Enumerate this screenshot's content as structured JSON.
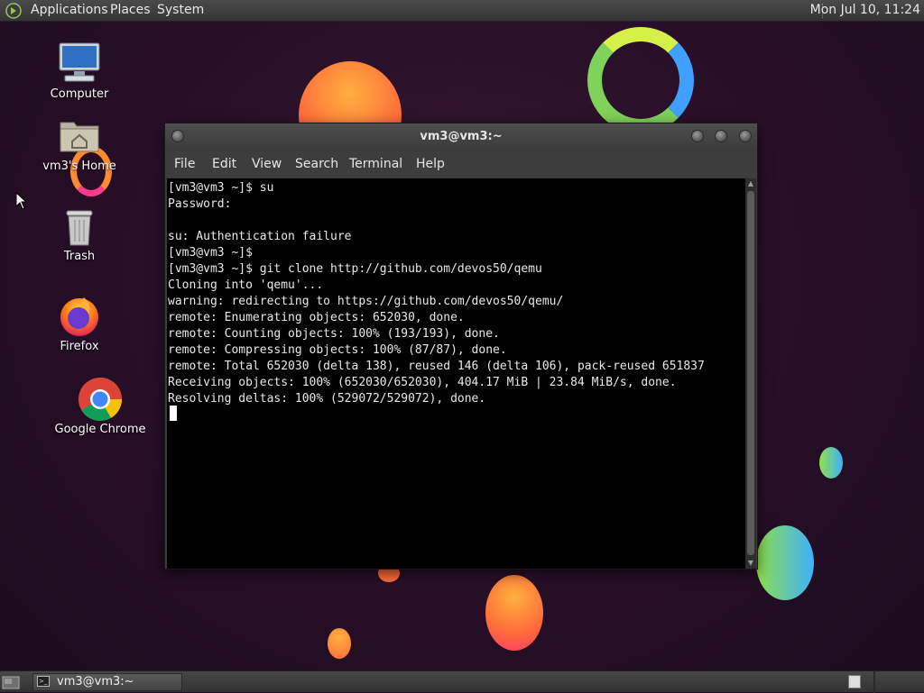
{
  "top_panel": {
    "menus": [
      "Applications",
      "Places",
      "System"
    ],
    "clock": "Mon Jul 10, 11:24",
    "icons": {
      "logo": "distro-logo-icon"
    }
  },
  "desktop": {
    "icons": [
      {
        "label": "Computer",
        "icon": "computer-icon"
      },
      {
        "label": "vm3's Home",
        "icon": "home-folder-icon"
      },
      {
        "label": "Trash",
        "icon": "trash-icon"
      },
      {
        "label": "Firefox",
        "icon": "firefox-icon"
      },
      {
        "label": "Google Chrome",
        "icon": "chrome-icon"
      }
    ]
  },
  "terminal_window": {
    "title": "vm3@vm3:~",
    "menu": [
      "File",
      "Edit",
      "View",
      "Search",
      "Terminal",
      "Help"
    ],
    "lines": [
      "[vm3@vm3 ~]$ su",
      "Password:",
      "",
      "su: Authentication failure",
      "[vm3@vm3 ~]$",
      "[vm3@vm3 ~]$ git clone http://github.com/devos50/qemu",
      "Cloning into 'qemu'...",
      "warning: redirecting to https://github.com/devos50/qemu/",
      "remote: Enumerating objects: 652030, done.",
      "remote: Counting objects: 100% (193/193), done.",
      "remote: Compressing objects: 100% (87/87), done.",
      "remote: Total 652030 (delta 138), reused 146 (delta 106), pack-reused 651837",
      "Receiving objects: 100% (652030/652030), 404.17 MiB | 23.84 MiB/s, done.",
      "Resolving deltas: 100% (529072/529072), done."
    ]
  },
  "bottom_panel": {
    "task_label": "vm3@vm3:~"
  }
}
